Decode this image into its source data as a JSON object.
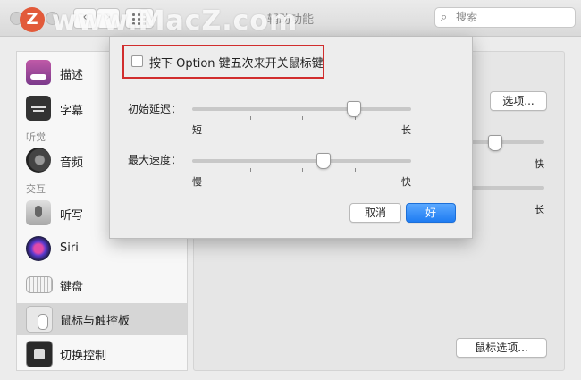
{
  "window": {
    "title": "辅助功能"
  },
  "search": {
    "placeholder": "搜索"
  },
  "watermark": {
    "logo": "Z",
    "text": "www.MacZ.com"
  },
  "nav": {
    "back": "‹",
    "forward": "›"
  },
  "sidebar": {
    "items": [
      {
        "label": "描述",
        "icon": "description-icon",
        "color": "#a04c8c"
      },
      {
        "label": "字幕",
        "icon": "captions-icon",
        "color": "#333333"
      },
      {
        "section": "听觉"
      },
      {
        "label": "音频",
        "icon": "speaker-icon",
        "color": "#555555"
      },
      {
        "section": "交互"
      },
      {
        "label": "听写",
        "icon": "microphone-icon",
        "color": "#9a9a9a"
      },
      {
        "label": "Siri",
        "icon": "siri-icon",
        "color": "#6a3fd0"
      },
      {
        "label": "键盘",
        "icon": "keyboard-icon",
        "color": "#dcdcdc"
      },
      {
        "label": "鼠标与触控板",
        "icon": "mouse-icon",
        "color": "#e0e0e0",
        "selected": true
      },
      {
        "label": "切换控制",
        "icon": "switch-control-icon",
        "color": "#333333"
      }
    ]
  },
  "pane": {
    "options_button": "选项...",
    "speed_fast": "快",
    "delay_long": "长",
    "mouse_options_button": "鼠标选项..."
  },
  "sheet": {
    "checkbox_label": "按下 Option 键五次来开关鼠标键",
    "checkbox_checked": false,
    "initial_delay": {
      "label": "初始延迟：",
      "min_label": "短",
      "max_label": "长",
      "value": 0.74
    },
    "max_speed": {
      "label": "最大速度：",
      "min_label": "慢",
      "max_label": "快",
      "value": 0.6
    },
    "cancel_button": "取消",
    "ok_button": "好"
  },
  "colors": {
    "accent": "#1e7cf2",
    "highlight_box": "#d12d2d"
  }
}
